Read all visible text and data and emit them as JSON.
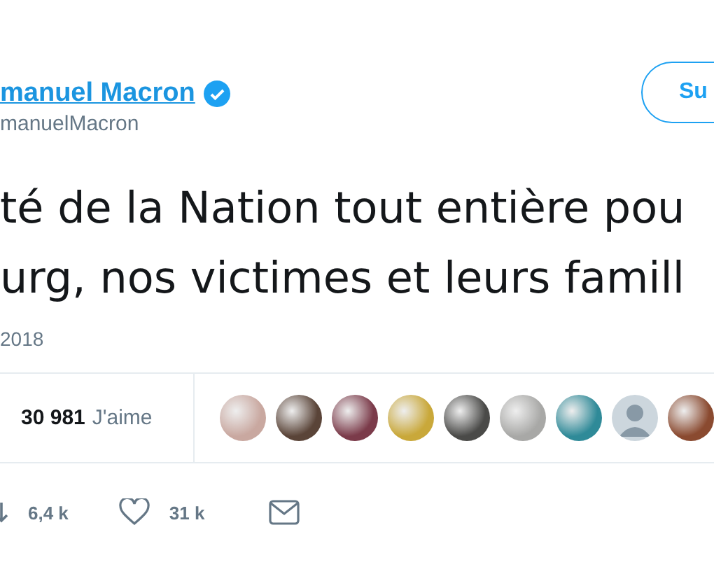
{
  "author": {
    "name": "manuel Macron",
    "verified": true,
    "handle": "manuelMacron"
  },
  "follow_button": {
    "label": "Su"
  },
  "tweet_lines": [
    "té de la Nation tout entière pou",
    "urg, nos victimes et leurs famill"
  ],
  "date": "2018",
  "stats": {
    "likes_count": "30 981",
    "likes_label": "J'aime"
  },
  "likers": [
    {
      "kind": "photo"
    },
    {
      "kind": "photo"
    },
    {
      "kind": "photo"
    },
    {
      "kind": "photo"
    },
    {
      "kind": "photo"
    },
    {
      "kind": "photo"
    },
    {
      "kind": "photo"
    },
    {
      "kind": "default"
    },
    {
      "kind": "photo"
    }
  ],
  "actions": {
    "retweets": "6,4 k",
    "likes": "31 k"
  }
}
